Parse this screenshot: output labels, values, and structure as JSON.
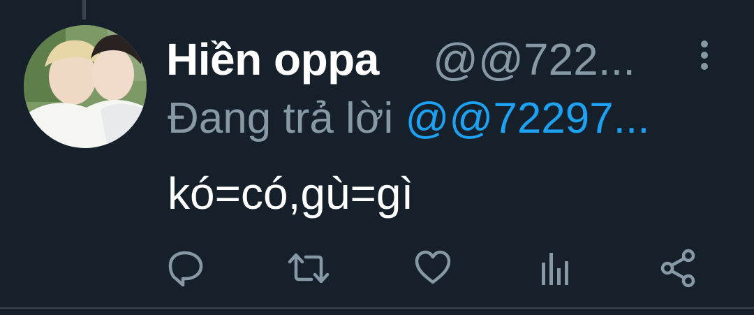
{
  "tweet": {
    "display_name": "Hiền oppa",
    "handle": "@@722...",
    "reply_label": "Đang trả lời",
    "reply_to_handle": "@@72297...",
    "text": "kó=có,gù=gì"
  },
  "icons": {
    "more": "more-vertical-icon",
    "reply": "reply-icon",
    "retweet": "retweet-icon",
    "like": "heart-icon",
    "analytics": "analytics-icon",
    "share": "share-icon"
  },
  "colors": {
    "background": "#15202b",
    "primary_text": "#ffffff",
    "secondary_text": "#8899a6",
    "accent": "#1da1f2",
    "divider": "#38444d"
  }
}
